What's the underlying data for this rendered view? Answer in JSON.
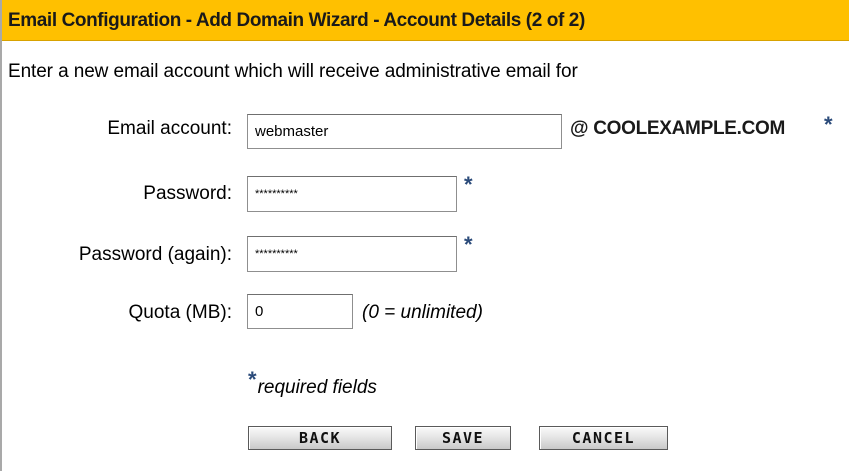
{
  "header": {
    "title": "Email Configuration - Add Domain Wizard - Account Details (2 of 2)"
  },
  "intro": {
    "text": "Enter a new email account which will receive administrative email for"
  },
  "form": {
    "email_label": "Email account:",
    "email_value": "webmaster",
    "domain_suffix": "@ COOLEXAMPLE.COM",
    "password_label": "Password:",
    "password_value": "**********",
    "password_again_label": "Password (again):",
    "password_again_value": "**********",
    "quota_label": "Quota (MB):",
    "quota_value": "0",
    "quota_hint": "(0 = unlimited)",
    "required_marker": "*",
    "required_note": "required fields"
  },
  "buttons": {
    "back": "BACK",
    "save": "SAVE",
    "cancel": "CANCEL"
  },
  "colors": {
    "title_bar": "#ffc000",
    "required_star": "#2b4b7a"
  }
}
